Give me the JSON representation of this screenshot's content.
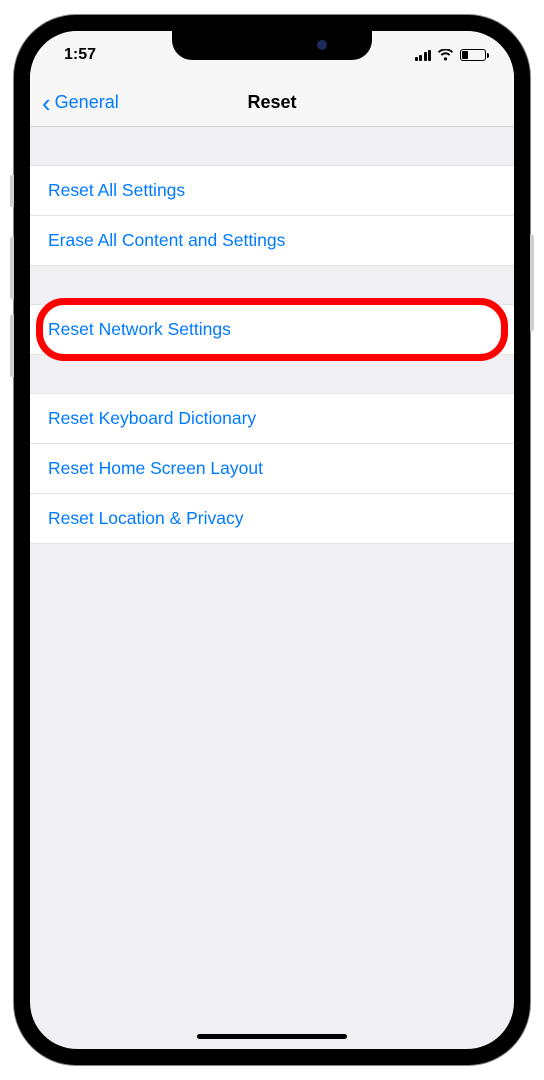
{
  "status": {
    "time": "1:57"
  },
  "nav": {
    "back_label": "General",
    "title": "Reset"
  },
  "sections": [
    {
      "items": [
        {
          "id": "reset-all-settings",
          "label": "Reset All Settings"
        },
        {
          "id": "erase-all-content",
          "label": "Erase All Content and Settings"
        }
      ]
    },
    {
      "items": [
        {
          "id": "reset-network-settings",
          "label": "Reset Network Settings",
          "highlighted": true
        }
      ]
    },
    {
      "items": [
        {
          "id": "reset-keyboard-dictionary",
          "label": "Reset Keyboard Dictionary"
        },
        {
          "id": "reset-home-screen-layout",
          "label": "Reset Home Screen Layout"
        },
        {
          "id": "reset-location-privacy",
          "label": "Reset Location & Privacy"
        }
      ]
    }
  ],
  "highlight_color": "#ff0000",
  "link_color": "#007aff"
}
